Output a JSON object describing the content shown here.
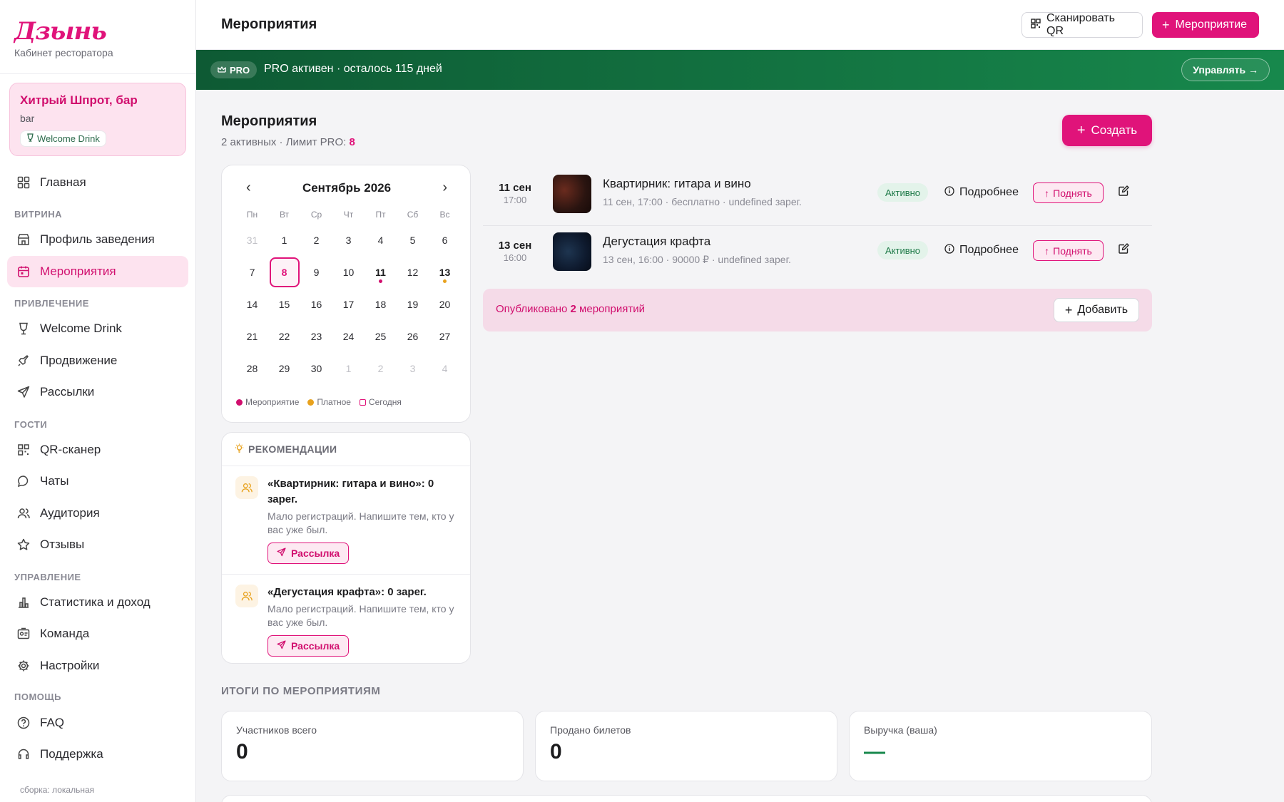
{
  "brand": {
    "logo": "Дзынь",
    "subtitle": "Кабинет ресторатора"
  },
  "venue": {
    "name": "Хитрый Шпрот, бар",
    "type": "bar",
    "badge": "Welcome Drink"
  },
  "nav": {
    "main": "Главная",
    "sec_showcase": "ВИТРИНА",
    "profile": "Профиль заведения",
    "events": "Мероприятия",
    "sec_attract": "ПРИВЛЕЧЕНИЕ",
    "welcome": "Welcome Drink",
    "promo": "Продвижение",
    "mailing": "Рассылки",
    "sec_guests": "ГОСТИ",
    "qr": "QR-сканер",
    "chats": "Чаты",
    "audience": "Аудитория",
    "reviews": "Отзывы",
    "sec_manage": "УПРАВЛЕНИЕ",
    "stats": "Статистика и доход",
    "team": "Команда",
    "settings": "Настройки",
    "sec_help": "ПОМОЩЬ",
    "faq": "FAQ",
    "support": "Поддержка",
    "build": "сборка: локальная"
  },
  "header": {
    "title": "Мероприятия",
    "scan_qr": "Сканировать QR",
    "add_event": "Мероприятие"
  },
  "pro": {
    "badge": "PRO",
    "text": "PRO активен · осталось 115 дней",
    "manage": "Управлять →"
  },
  "section": {
    "title": "Мероприятия",
    "sub_prefix": "2 активных · Лимит PRO: ",
    "limit": "8",
    "create": "Создать"
  },
  "calendar": {
    "month": "Сентябрь 2026",
    "prev": "‹",
    "next": "›",
    "dow": [
      "Пн",
      "Вт",
      "Ср",
      "Чт",
      "Пт",
      "Сб",
      "Вс"
    ],
    "days": [
      {
        "d": "31",
        "muted": true
      },
      {
        "d": "1"
      },
      {
        "d": "2"
      },
      {
        "d": "3"
      },
      {
        "d": "4"
      },
      {
        "d": "5"
      },
      {
        "d": "6"
      },
      {
        "d": "7"
      },
      {
        "d": "8",
        "today": true
      },
      {
        "d": "9"
      },
      {
        "d": "10"
      },
      {
        "d": "11",
        "event": true,
        "dot": "#d10f6e"
      },
      {
        "d": "12"
      },
      {
        "d": "13",
        "event": true,
        "dot": "#e8a21e"
      },
      {
        "d": "14"
      },
      {
        "d": "15"
      },
      {
        "d": "16"
      },
      {
        "d": "17"
      },
      {
        "d": "18"
      },
      {
        "d": "19"
      },
      {
        "d": "20"
      },
      {
        "d": "21"
      },
      {
        "d": "22"
      },
      {
        "d": "23"
      },
      {
        "d": "24"
      },
      {
        "d": "25"
      },
      {
        "d": "26"
      },
      {
        "d": "27"
      },
      {
        "d": "28"
      },
      {
        "d": "29"
      },
      {
        "d": "30"
      },
      {
        "d": "1",
        "muted": true
      },
      {
        "d": "2",
        "muted": true
      },
      {
        "d": "3",
        "muted": true
      },
      {
        "d": "4",
        "muted": true
      }
    ],
    "legend_event": "Мероприятие",
    "legend_paid": "Платное",
    "legend_today": "Сегодня",
    "colors": {
      "event": "#d10f6e",
      "paid": "#e8a21e"
    }
  },
  "recommendations": {
    "title": "РЕКОМЕНДАЦИИ",
    "items": [
      {
        "title": "«Квартирник: гитара и вино»: 0 зарег.",
        "text": "Мало регистраций. Напишите тем, кто у вас уже был.",
        "action": "Рассылка"
      },
      {
        "title": "«Дегустация крафта»: 0 зарег.",
        "text": "Мало регистраций. Напишите тем, кто у вас уже был.",
        "action": "Рассылка"
      }
    ]
  },
  "events": [
    {
      "date": "11 сен",
      "time": "17:00",
      "title": "Квартирник: гитара и вино",
      "meta": "11 сен, 17:00 · бесплатно · undefined зарег.",
      "status": "Активно",
      "more": "Подробнее",
      "raise": "Поднять",
      "thumb": "#2a1410"
    },
    {
      "date": "13 сен",
      "time": "16:00",
      "title": "Дегустация крафта",
      "meta": "13 сен, 16:00 · 90000 ₽ · undefined зарег.",
      "status": "Активно",
      "more": "Подробнее",
      "raise": "Поднять",
      "thumb": "#0e1a2e"
    }
  ],
  "published": {
    "prefix": "Опубликовано ",
    "count": "2",
    "suffix": " мероприятий",
    "add": "Добавить"
  },
  "totals": {
    "title": "ИТОГИ ПО МЕРОПРИЯТИЯМ",
    "participants_label": "Участников всего",
    "participants": "0",
    "tickets_label": "Продано билетов",
    "tickets": "0",
    "revenue_label": "Выручка (ваша)",
    "revenue": "—"
  },
  "theme": {
    "accent": "#e0137a",
    "pro_green": "#17884c"
  }
}
